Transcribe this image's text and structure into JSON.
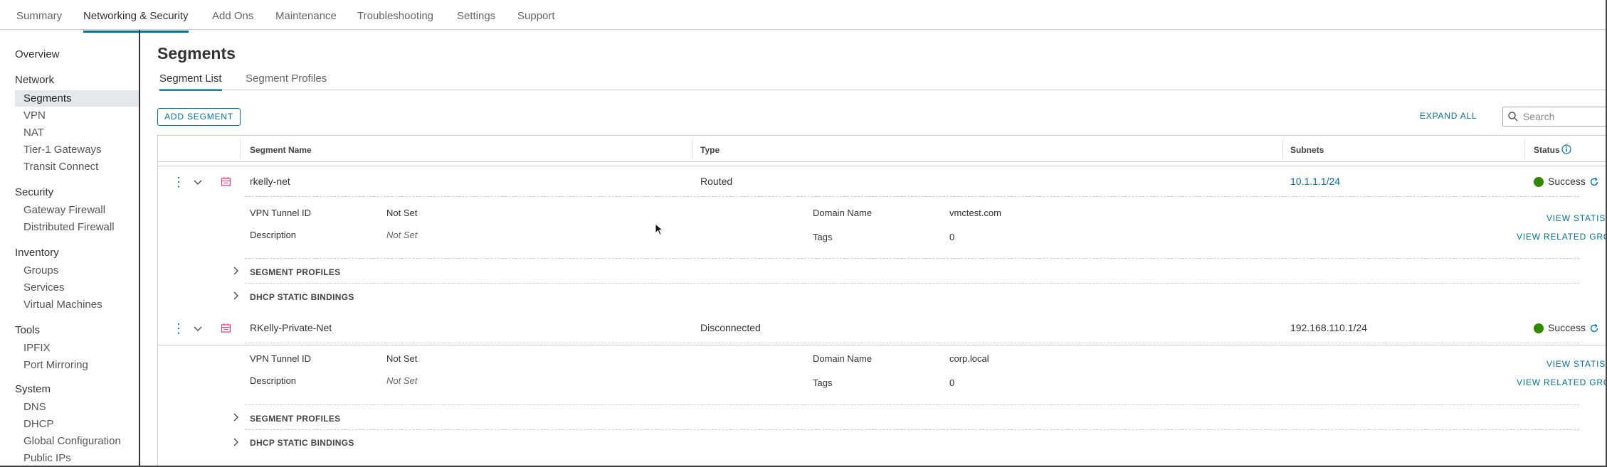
{
  "top_tabs": [
    "Summary",
    "Networking & Security",
    "Add Ons",
    "Maintenance",
    "Troubleshooting",
    "Settings",
    "Support"
  ],
  "sidebar": {
    "overview": "Overview",
    "network": {
      "title": "Network",
      "items": [
        "Segments",
        "VPN",
        "NAT",
        "Tier-1 Gateways",
        "Transit Connect"
      ]
    },
    "security": {
      "title": "Security",
      "items": [
        "Gateway Firewall",
        "Distributed Firewall"
      ]
    },
    "inventory": {
      "title": "Inventory",
      "items": [
        "Groups",
        "Services",
        "Virtual Machines"
      ]
    },
    "tools": {
      "title": "Tools",
      "items": [
        "IPFIX",
        "Port Mirroring"
      ]
    },
    "system": {
      "title": "System",
      "items": [
        "DNS",
        "DHCP",
        "Global Configuration",
        "Public IPs"
      ]
    }
  },
  "page": {
    "title": "Segments",
    "subtabs": [
      "Segment List",
      "Segment Profiles"
    ],
    "add_button": "ADD SEGMENT",
    "expand_all": "EXPAND ALL",
    "search_placeholder": "Search"
  },
  "table": {
    "columns": [
      "Segment Name",
      "Type",
      "Subnets",
      "Status"
    ],
    "rows": [
      {
        "name": "rkelly-net",
        "type": "Routed",
        "subnet": "10.1.1.1/24",
        "status": "Success",
        "vpn_label": "VPN Tunnel ID",
        "vpn_value": "Not Set",
        "desc_label": "Description",
        "desc_value": "Not Set",
        "domain_label": "Domain Name",
        "domain_value": "vmctest.com",
        "tags_label": "Tags",
        "tags_value": "0",
        "view_stats": "VIEW STATIS",
        "view_related": "VIEW RELATED GRC",
        "segment_profiles": "SEGMENT PROFILES",
        "dhcp_bindings": "DHCP STATIC BINDINGS"
      },
      {
        "name": "RKelly-Private-Net",
        "type": "Disconnected",
        "subnet": "192.168.110.1/24",
        "status": "Success",
        "vpn_label": "VPN Tunnel ID",
        "vpn_value": "Not Set",
        "desc_label": "Description",
        "desc_value": "Not Set",
        "domain_label": "Domain Name",
        "domain_value": "corp.local",
        "tags_label": "Tags",
        "tags_value": "0",
        "view_stats": "VIEW STATIS",
        "view_related": "VIEW RELATED GRC",
        "segment_profiles": "SEGMENT PROFILES",
        "dhcp_bindings": "DHCP STATIC BINDINGS"
      }
    ]
  },
  "colors": {
    "accent": "#0072a3",
    "success": "#318700",
    "segment_icon": "#e0467c"
  },
  "icons": [
    "search-icon",
    "kebab-icon",
    "chevron-down-icon",
    "chevron-right-icon",
    "segment-icon",
    "refresh-icon",
    "info-icon",
    "status-success-icon"
  ]
}
